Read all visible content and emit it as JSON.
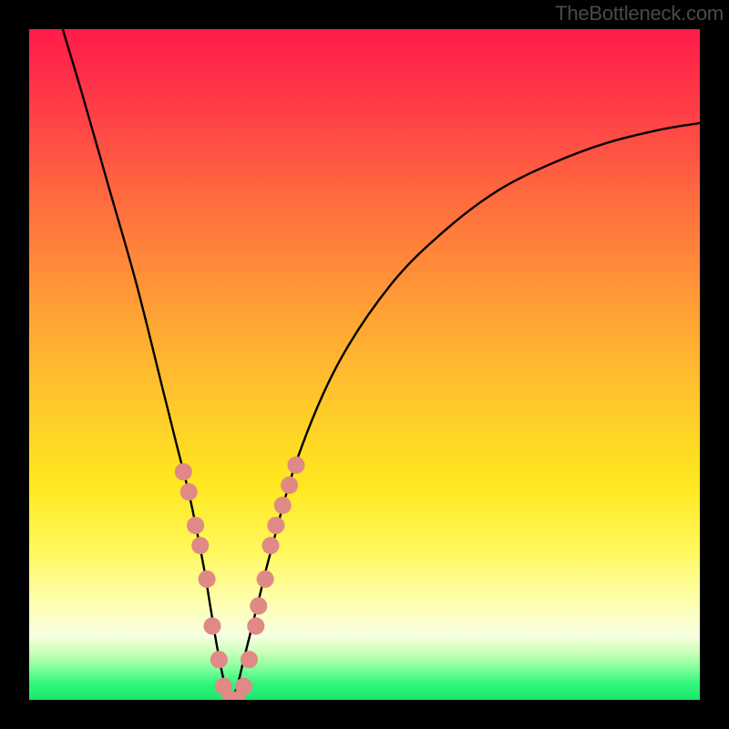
{
  "watermark": {
    "text": "TheBottleneck.com"
  },
  "gradient": {
    "stops": [
      {
        "offset": 0.0,
        "color": "#ff1b4b"
      },
      {
        "offset": 0.12,
        "color": "#ff3e47"
      },
      {
        "offset": 0.25,
        "color": "#ff6a3f"
      },
      {
        "offset": 0.4,
        "color": "#ff9a36"
      },
      {
        "offset": 0.55,
        "color": "#ffc62c"
      },
      {
        "offset": 0.68,
        "color": "#ffe81f"
      },
      {
        "offset": 0.78,
        "color": "#fff85e"
      },
      {
        "offset": 0.86,
        "color": "#feffb5"
      },
      {
        "offset": 0.905,
        "color": "#f6ffe0"
      },
      {
        "offset": 0.93,
        "color": "#c9ffb8"
      },
      {
        "offset": 0.955,
        "color": "#7aff9a"
      },
      {
        "offset": 0.975,
        "color": "#34f57e"
      },
      {
        "offset": 1.0,
        "color": "#18e86b"
      }
    ]
  },
  "chart_data": {
    "type": "line",
    "title": "",
    "xlabel": "",
    "ylabel": "",
    "xlim": [
      0,
      100
    ],
    "ylim": [
      0,
      100
    ],
    "grid": false,
    "series": [
      {
        "name": "bottleneck-curve",
        "color": "#000000",
        "x": [
          5,
          8,
          12,
          16,
          20,
          22,
          24,
          26,
          27,
          28,
          29,
          30,
          31,
          32,
          34,
          36,
          40,
          46,
          54,
          62,
          70,
          78,
          86,
          94,
          100
        ],
        "y": [
          100,
          90,
          76,
          62,
          46,
          38,
          30,
          20,
          14,
          8,
          3,
          0,
          2,
          6,
          14,
          22,
          36,
          50,
          62,
          70,
          76,
          80,
          83,
          85,
          86
        ]
      }
    ],
    "highlight_markers": {
      "name": "highlight-dots",
      "color": "#e08a87",
      "radius_pct": 1.3,
      "points": [
        {
          "x": 23.0,
          "y": 34
        },
        {
          "x": 23.8,
          "y": 31
        },
        {
          "x": 24.8,
          "y": 26
        },
        {
          "x": 25.5,
          "y": 23
        },
        {
          "x": 26.5,
          "y": 18
        },
        {
          "x": 27.3,
          "y": 11
        },
        {
          "x": 28.3,
          "y": 6
        },
        {
          "x": 29.0,
          "y": 2
        },
        {
          "x": 30.0,
          "y": 0
        },
        {
          "x": 31.0,
          "y": 0
        },
        {
          "x": 32.0,
          "y": 2
        },
        {
          "x": 32.8,
          "y": 6
        },
        {
          "x": 33.8,
          "y": 11
        },
        {
          "x": 34.2,
          "y": 14
        },
        {
          "x": 35.2,
          "y": 18
        },
        {
          "x": 36.0,
          "y": 23
        },
        {
          "x": 36.8,
          "y": 26
        },
        {
          "x": 37.8,
          "y": 29
        },
        {
          "x": 38.8,
          "y": 32
        },
        {
          "x": 39.8,
          "y": 35
        }
      ]
    }
  }
}
